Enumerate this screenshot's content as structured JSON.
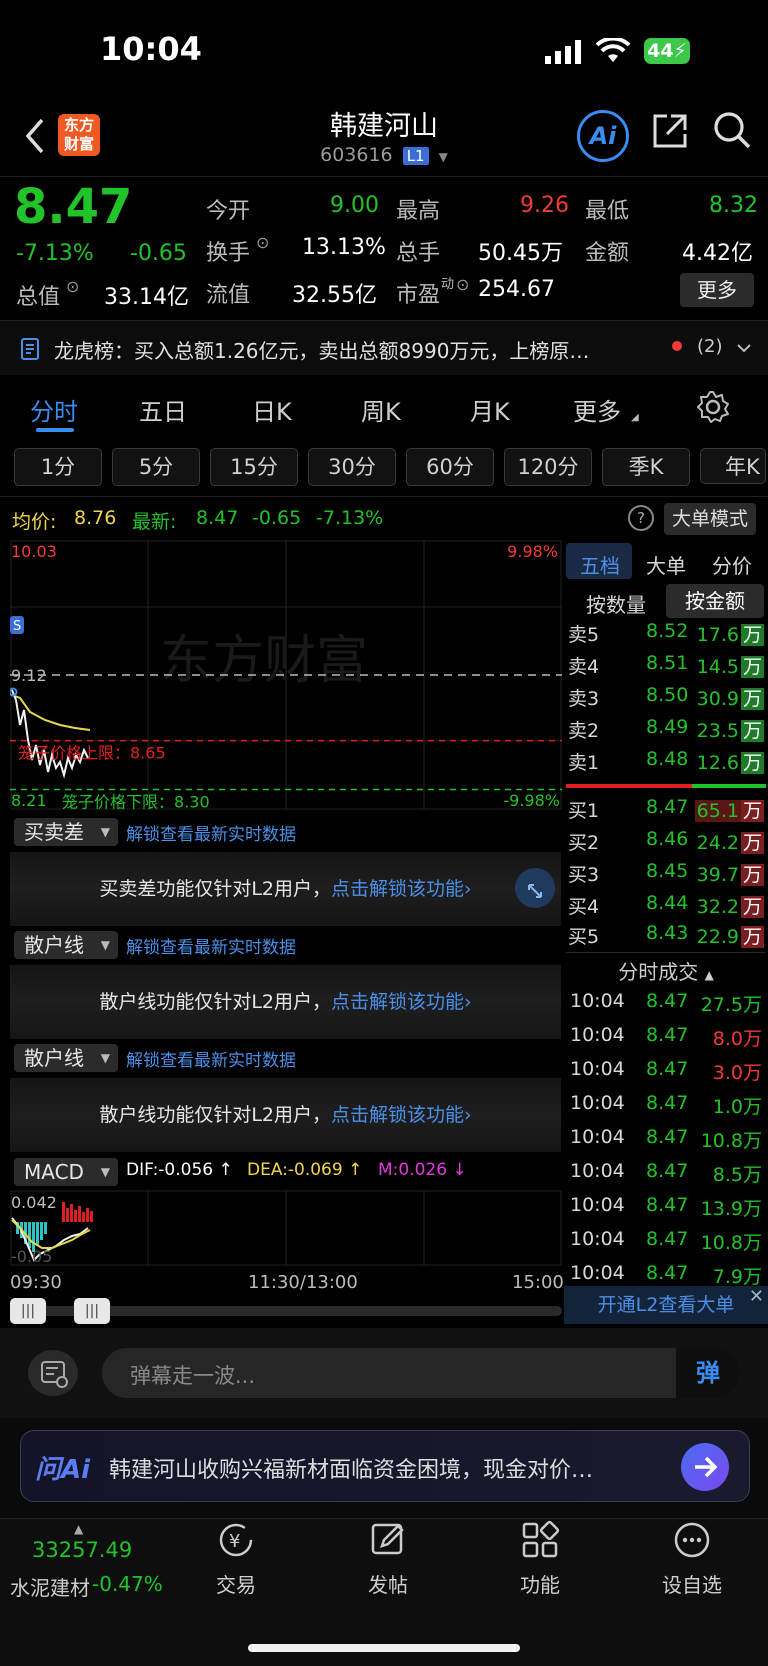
{
  "status": {
    "time": "10:04",
    "battery": "44"
  },
  "header": {
    "title": "韩建河山",
    "code": "603616",
    "level": "L1",
    "logo_line1": "东方",
    "logo_line2": "财富",
    "ai_label": "Ai"
  },
  "quote": {
    "price": "8.47",
    "change_pct": "-7.13%",
    "change": "-0.65",
    "open_label": "今开",
    "open": "9.00",
    "high_label": "最高",
    "high": "9.26",
    "low_label": "最低",
    "low": "8.32",
    "turnover_label": "换手",
    "turnover": "13.13%",
    "volume_label": "总手",
    "volume": "50.45万",
    "amount_label": "金额",
    "amount": "4.42亿",
    "mktcap_label": "总值",
    "mktcap": "33.14亿",
    "float_label": "流值",
    "float": "32.55亿",
    "pe_label": "市盈",
    "pe_sup": "动",
    "pe": "254.67",
    "more_label": "更多"
  },
  "news": {
    "text": "龙虎榜：买入总额1.26亿元，卖出总额8990万元，上榜原…",
    "count": "(2)"
  },
  "tabs": [
    "分时",
    "五日",
    "日K",
    "周K",
    "月K",
    "更多"
  ],
  "ktabs": [
    "1分",
    "5分",
    "15分",
    "30分",
    "60分",
    "120分",
    "季K",
    "年K"
  ],
  "info": {
    "avg_label": "均价:",
    "avg": "8.76",
    "latest_label": "最新:",
    "latest": "8.47",
    "chg": "-0.65",
    "pct": "-7.13%",
    "bigorder_label": "大单模式"
  },
  "chart": {
    "top_left": "10.03",
    "top_right": "9.98%",
    "mid": "9.12",
    "bot_left": "8.21",
    "bot_right": "-9.98%",
    "watermark": "东方财富",
    "upper_limit": "笼子价格上限：8.65",
    "lower_limit": "笼子价格下限：8.30",
    "time_start": "09:30",
    "time_mid": "11:30/13:00",
    "time_end": "15:00",
    "s_badge": "S"
  },
  "chart_data": {
    "type": "line",
    "x_range": [
      "09:30",
      "15:00"
    ],
    "ylim": [
      8.21,
      10.03
    ],
    "prev_close": 9.12,
    "upper_limit": 8.65,
    "lower_limit": 8.3,
    "last_price": 8.47,
    "avg_price": 8.76
  },
  "panels": {
    "p1": {
      "label": "买卖差",
      "link": "解锁查看最新实时数据",
      "msg": "买卖差功能仅针对L2用户，",
      "cta": "点击解锁该功能"
    },
    "p2": {
      "label": "散户线",
      "link": "解锁查看最新实时数据",
      "msg": "散户线功能仅针对L2用户，",
      "cta": "点击解锁该功能"
    },
    "p3": {
      "label": "散户线",
      "link": "解锁查看最新实时数据",
      "msg": "散户线功能仅针对L2用户，",
      "cta": "点击解锁该功能"
    }
  },
  "macd": {
    "label": "MACD",
    "dif": "DIF:-0.056 ↑",
    "dea": "DEA:-0.069 ↑",
    "m": "M:0.026 ↓",
    "top": "0.042",
    "bottom": "-0.05"
  },
  "orderbook": {
    "tabs": [
      "五档",
      "大单",
      "分价"
    ],
    "subtabs": [
      "按数量",
      "按金额"
    ],
    "sell": [
      {
        "label": "卖5",
        "price": "8.52",
        "amount": "17.6",
        "unit": "万"
      },
      {
        "label": "卖4",
        "price": "8.51",
        "amount": "14.5",
        "unit": "万"
      },
      {
        "label": "卖3",
        "price": "8.50",
        "amount": "30.9",
        "unit": "万"
      },
      {
        "label": "卖2",
        "price": "8.49",
        "amount": "23.5",
        "unit": "万"
      },
      {
        "label": "卖1",
        "price": "8.48",
        "amount": "12.6",
        "unit": "万"
      }
    ],
    "buy": [
      {
        "label": "买1",
        "price": "8.47",
        "amount": "65.1",
        "unit": "万"
      },
      {
        "label": "买2",
        "price": "8.46",
        "amount": "24.2",
        "unit": "万"
      },
      {
        "label": "买3",
        "price": "8.45",
        "amount": "39.7",
        "unit": "万"
      },
      {
        "label": "买4",
        "price": "8.44",
        "amount": "32.2",
        "unit": "万"
      },
      {
        "label": "买5",
        "price": "8.43",
        "amount": "22.9",
        "unit": "万"
      }
    ]
  },
  "trades": {
    "title": "分时成交",
    "rows": [
      {
        "time": "10:04",
        "price": "8.47",
        "vol": "27.5万",
        "dir": "green"
      },
      {
        "time": "10:04",
        "price": "8.47",
        "vol": "8.0万",
        "dir": "red"
      },
      {
        "time": "10:04",
        "price": "8.47",
        "vol": "3.0万",
        "dir": "red"
      },
      {
        "time": "10:04",
        "price": "8.47",
        "vol": "1.0万",
        "dir": "green"
      },
      {
        "time": "10:04",
        "price": "8.47",
        "vol": "10.8万",
        "dir": "green"
      },
      {
        "time": "10:04",
        "price": "8.47",
        "vol": "8.5万",
        "dir": "green"
      },
      {
        "time": "10:04",
        "price": "8.47",
        "vol": "13.9万",
        "dir": "green"
      },
      {
        "time": "10:04",
        "price": "8.47",
        "vol": "10.8万",
        "dir": "green"
      },
      {
        "time": "10:04",
        "price": "8.47",
        "vol": "7.9万",
        "dir": "green"
      }
    ],
    "l2_cta": "开通L2查看大单"
  },
  "danmu": {
    "placeholder": "弹幕走一波...",
    "send": "弹"
  },
  "ai_bar": {
    "brand": "问Ai",
    "text": "韩建河山收购兴福新材面临资金困境，现金对价…"
  },
  "bottom_nav": {
    "index_value": "33257.49",
    "index_name": "水泥建材",
    "index_chg": "-0.47%",
    "items": [
      "交易",
      "发帖",
      "功能",
      "设自选"
    ]
  }
}
